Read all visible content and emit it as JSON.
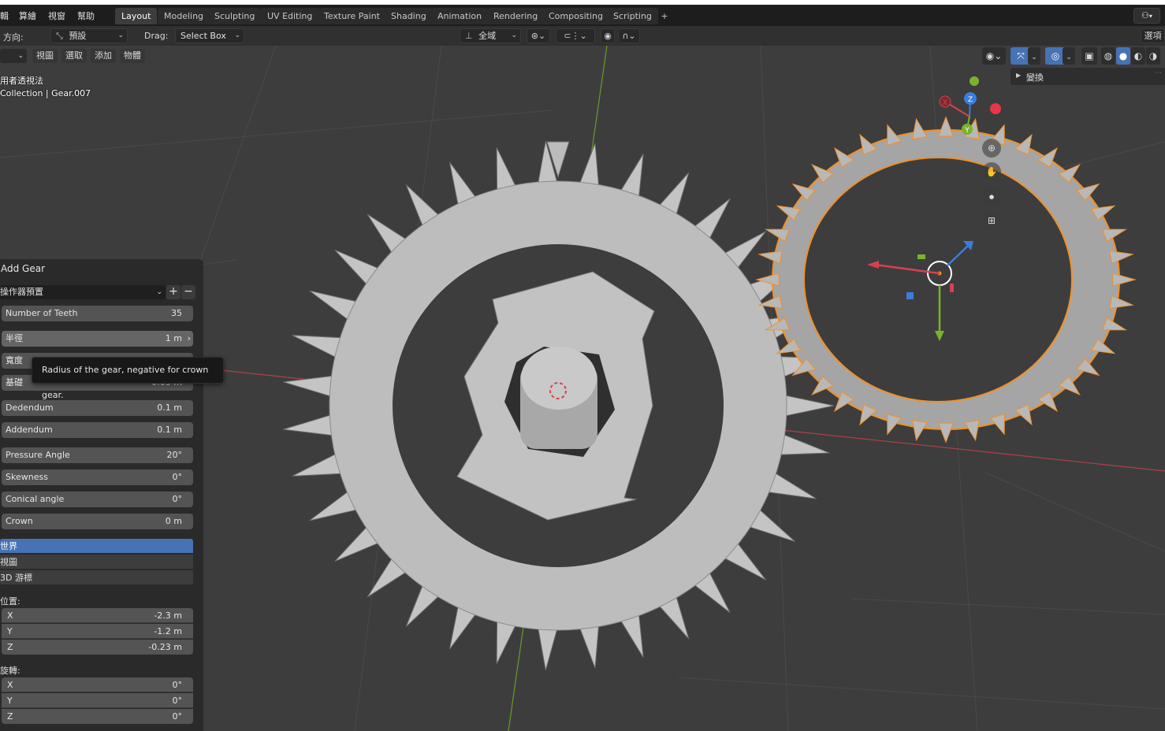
{
  "menubar": {
    "items": [
      "輯",
      "算繪",
      "視窗",
      "幫助"
    ],
    "tabs": [
      "Layout",
      "Modeling",
      "Sculpting",
      "UV Editing",
      "Texture Paint",
      "Shading",
      "Animation",
      "Rendering",
      "Compositing",
      "Scripting"
    ],
    "active_tab": "Layout",
    "add_tab": "+"
  },
  "toolbar": {
    "orientation_label": "方向:",
    "orientation_value": "預設",
    "drag_label": "Drag:",
    "drag_value": "Select Box",
    "pivot_value": "全域",
    "options_label": "選項"
  },
  "subbar": {
    "items": [
      "視圖",
      "選取",
      "添加",
      "物體"
    ]
  },
  "viewport": {
    "view_name": "用者透視法",
    "collection_info": "Collection | Gear.007",
    "npanel_transform": "變換",
    "gizmo_axes": {
      "x": "X",
      "y": "Y",
      "z": "Z"
    }
  },
  "redo_panel": {
    "title": "Add Gear",
    "preset": "操作器預置",
    "preset_add": "+",
    "preset_remove": "−",
    "fields": [
      {
        "label": "Number of Teeth",
        "value": "35"
      },
      {
        "label": "半徑",
        "value": "1 m"
      },
      {
        "label": "寬度",
        "value": ""
      },
      {
        "label": "基礎",
        "value": "0.05 m"
      },
      {
        "label": "Dedendum",
        "value": "0.1 m"
      },
      {
        "label": "Addendum",
        "value": "0.1 m"
      },
      {
        "label": "Pressure Angle",
        "value": "20°"
      },
      {
        "label": "Skewness",
        "value": "0°"
      },
      {
        "label": "Conical angle",
        "value": "0°"
      },
      {
        "label": "Crown",
        "value": "0 m"
      }
    ],
    "align_options": [
      "世界",
      "視圖",
      "3D 游標"
    ],
    "location_label": "位置:",
    "location": [
      {
        "axis": "X",
        "value": "-2.3 m"
      },
      {
        "axis": "Y",
        "value": "-1.2 m"
      },
      {
        "axis": "Z",
        "value": "-0.23 m"
      }
    ],
    "rotation_label": "旋轉:",
    "rotation": [
      {
        "axis": "X",
        "value": "0°"
      },
      {
        "axis": "Y",
        "value": "0°"
      },
      {
        "axis": "Z",
        "value": "0°"
      }
    ]
  },
  "tooltip": {
    "text": "Radius of the gear, negative for crown gear."
  },
  "colors": {
    "accent": "#4772b3",
    "selection_outline": "#f0902a",
    "x_axis": "#d5424f",
    "y_axis": "#7ab22e",
    "z_axis": "#3b7ddb"
  }
}
